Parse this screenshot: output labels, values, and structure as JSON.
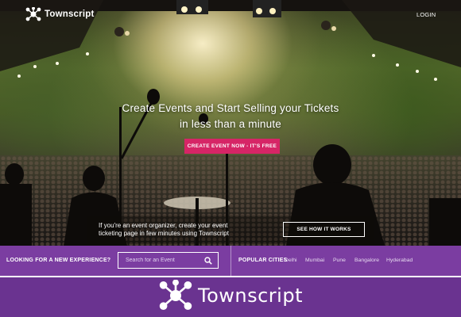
{
  "header": {
    "brand": "Townscript",
    "login_label": "LOGIN"
  },
  "hero": {
    "title_line1": "Create Events and Start Selling your Tickets",
    "title_line2": "in less than a minute",
    "cta_label": "CREATE EVENT NOW - IT'S FREE",
    "organizer_line1": "If you're an event organizer, create your event",
    "organizer_line2": "ticketing page in few minutes using Townscript",
    "how_label": "SEE HOW IT WORKS"
  },
  "discover": {
    "looking_label": "LOOKING FOR A NEW EXPERIENCE?",
    "search_placeholder": "Search for an Event",
    "popular_label": "POPULAR CITIES",
    "cities": [
      "Delhi",
      "Mumbai",
      "Pune",
      "Bangalore",
      "Hyderabad"
    ]
  },
  "banner": {
    "brand": "Townscript"
  },
  "icons": {
    "logo": "townscript-node-logo-icon",
    "search": "search-icon"
  },
  "colors": {
    "cta_pink": "#d62566",
    "bar_purple": "#7b3da1",
    "banner_purple": "#6a3390"
  }
}
